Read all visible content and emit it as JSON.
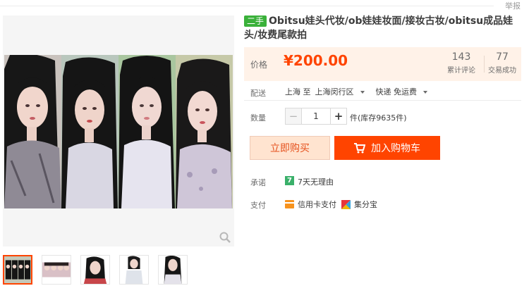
{
  "header": {
    "report_label": "举报"
  },
  "gallery": {
    "thumbnails": [
      "doll-group-1",
      "doll-group-2",
      "doll-portrait-1",
      "doll-portrait-2",
      "doll-portrait-3"
    ]
  },
  "product": {
    "badge": "二手",
    "title": "Obitsu娃头代妆/ob娃娃妆面/接妆古妆/obitsu成品娃头/妆费尾款拍"
  },
  "price": {
    "label": "价格",
    "value": "¥200.00",
    "reviews_count": "143",
    "reviews_label": "累计评论",
    "deals_count": "77",
    "deals_label": "交易成功"
  },
  "shipping": {
    "label": "配送",
    "from": "上海 至",
    "to": "上海闵行区",
    "method": "快递 免运费"
  },
  "quantity": {
    "label": "数量",
    "minus": "−",
    "value": "1",
    "plus": "+",
    "stock": "件(库存9635件)"
  },
  "actions": {
    "buy_now": "立即购买",
    "add_to_cart": "加入购物车"
  },
  "promise": {
    "label": "承诺",
    "icon_text": "7",
    "text": "7天无理由"
  },
  "payment": {
    "label": "支付",
    "methods": [
      "信用卡支付",
      "集分宝"
    ]
  },
  "colors": {
    "accent": "#ff4400",
    "badge": "#3ab13a",
    "price_bg": "#fff2e8"
  }
}
